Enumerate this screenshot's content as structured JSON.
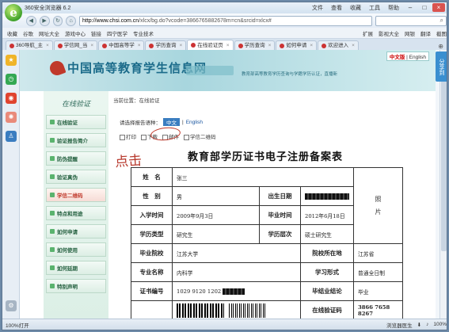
{
  "browser": {
    "title": "360安全浏览器 6.2",
    "menu": [
      "文件",
      "查看",
      "收藏",
      "工具",
      "帮助"
    ],
    "url_host": "http://www.chsi.com.cn",
    "url_path": "/xlcx/bg.do?vcode=3866765882678m=cn&srcid=xlcx#",
    "bookmarks": [
      "收藏",
      "谷歌",
      "网址大全",
      "游戏中心",
      "链接",
      "四宁医学",
      "专业技术"
    ],
    "bookmarks_right": [
      "扩展",
      "影视大全",
      "网银",
      "翻译",
      "截图"
    ],
    "tabs": [
      {
        "label": "360导航_主",
        "active": false
      },
      {
        "label": "学信网_当",
        "active": false
      },
      {
        "label": "中国高等学",
        "active": false
      },
      {
        "label": "学历查询",
        "active": false
      },
      {
        "label": "在线验证页",
        "active": true
      },
      {
        "label": "学历查询",
        "active": false
      },
      {
        "label": "如何申请",
        "active": false
      },
      {
        "label": "欢迎进入",
        "active": false
      }
    ],
    "status_left": "100%打开",
    "status_right": "浏览器医生",
    "zoom": "100%",
    "share": "分享到"
  },
  "site": {
    "title": "中国高等教育学生信息网",
    "note": "教育部高等教育学历查询与学籍学历认证，直播新",
    "lang": {
      "cn": "中文版",
      "sep": " | ",
      "en": "English"
    }
  },
  "sidemenu": {
    "heading": "在线验证",
    "items": [
      {
        "label": "在线验证",
        "selected": false
      },
      {
        "label": "验证报告简介",
        "selected": false
      },
      {
        "label": "防伪提醒",
        "selected": false
      },
      {
        "label": "验证真伪",
        "selected": false
      },
      {
        "label": "学信二维码",
        "selected": true
      },
      {
        "label": "特点和用途",
        "selected": false
      },
      {
        "label": "如何申请",
        "selected": false
      },
      {
        "label": "如何使用",
        "selected": false
      },
      {
        "label": "如何延期",
        "selected": false
      },
      {
        "label": "特别声明",
        "selected": false
      }
    ]
  },
  "main": {
    "breadcrumb": "当前位置：在线验证",
    "lang_label": "请选择报告语种：",
    "lang_zh": "中文",
    "lang_sep": "|",
    "lang_en": "English",
    "actions": {
      "print": "打印",
      "download": "下载",
      "mail": "邮件",
      "qr": "学信二维码"
    },
    "handwriting": "点击",
    "doc_title": "教育部学历证书电子注册备案表",
    "photo": "照\n片",
    "fields": {
      "name_label": "姓　名",
      "name_value": "张三",
      "gender_label": "性　别",
      "gender_value": "男",
      "dob_label": "出生日期",
      "enroll_label": "入学时间",
      "enroll_value": "2009年9月3日",
      "grad_label": "毕业时间",
      "grad_value": "2012年6月18日",
      "type_label": "学历类型",
      "type_value": "研究生",
      "level_label": "学历层次",
      "level_value": "硕士研究生",
      "school_label": "毕业院校",
      "school_value": "江苏大学",
      "loc_label": "院校所在地",
      "loc_value": "江苏省",
      "major_label": "专业名称",
      "major_value": "内科学",
      "form_label": "学习形式",
      "form_value": "普通全日制",
      "cert_label": "证书编号",
      "cert_value": "1029 9120 1202",
      "result_label": "毕结业结论",
      "result_value": "毕业",
      "vcode_label": "在线验证码",
      "vcode_value": "3866 7658 8267"
    }
  }
}
